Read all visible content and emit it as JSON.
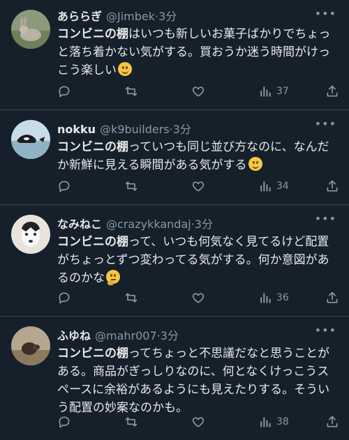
{
  "tweets": [
    {
      "name": "あららぎ",
      "handle": "@Jimbek",
      "separator": "·",
      "time": "3分",
      "text_bold": "コンビニの棚",
      "text_rest": "はいつも新しいお菓子ばかりでちょっと落ち着かない気がする。買おうか迷う時間がけっこう楽しい",
      "emoji": "smile",
      "views": "37"
    },
    {
      "name": "nokku",
      "handle": "@k9builders",
      "separator": "·",
      "time": "3分",
      "text_bold": "コンビニの棚",
      "text_rest": "っていつも同じ並び方なのに、なんだか新鮮に見える瞬間がある気がする",
      "emoji": "smile",
      "views": "34"
    },
    {
      "name": "なみねこ",
      "handle": "@crazykkandaj",
      "separator": "·",
      "time": "3分",
      "text_bold": "コンビニの棚",
      "text_rest": "って、いつも何気なく見てるけど配置がちょっとずつ変わってる気がする。何か意図があるのかな",
      "emoji": "thinking",
      "views": "36"
    },
    {
      "name": "ふゆね",
      "handle": "@mahr007",
      "separator": "·",
      "time": "3分",
      "text_bold": "コンビニの棚",
      "text_rest": "ってちょっと不思議だなと思うことがある。商品がぎっしりなのに、何となくけっこうスペースに余裕があるようにも見えたりする。そういう配置の妙案なのかも。",
      "emoji": "",
      "views": "38"
    }
  ],
  "more_label": "•••",
  "colors": {
    "background": "#15202b",
    "text": "#e7e9ea",
    "muted": "#8b98a5",
    "divider": "#38444d"
  },
  "icons": [
    "reply-icon",
    "retweet-icon",
    "like-icon",
    "views-icon",
    "share-icon",
    "more-icon"
  ]
}
